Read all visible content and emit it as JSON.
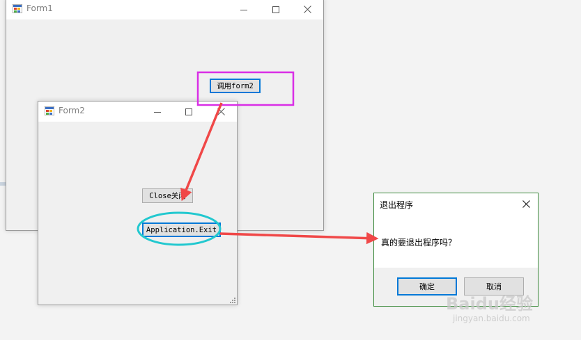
{
  "form1": {
    "title": "Form1",
    "button_call_form2": "调用form2"
  },
  "form2": {
    "title": "Form2",
    "button_close": "Close关闭",
    "button_exit": "Application.Exit"
  },
  "dialog": {
    "title": "退出程序",
    "message": "真的要退出程序吗？",
    "ok_label": "确定",
    "cancel_label": "取消"
  },
  "watermark": {
    "brand": "Baidu经验",
    "url": "jingyan.baidu.com"
  },
  "colors": {
    "highlight_box": "#d92ee6",
    "highlight_ellipse": "#22c8cf",
    "arrow": "#f04848",
    "focus_border": "#0078d7"
  },
  "icons": {
    "app": "winforms-app-icon",
    "minimize": "minimize-icon",
    "maximize": "maximize-icon",
    "close": "close-icon"
  }
}
